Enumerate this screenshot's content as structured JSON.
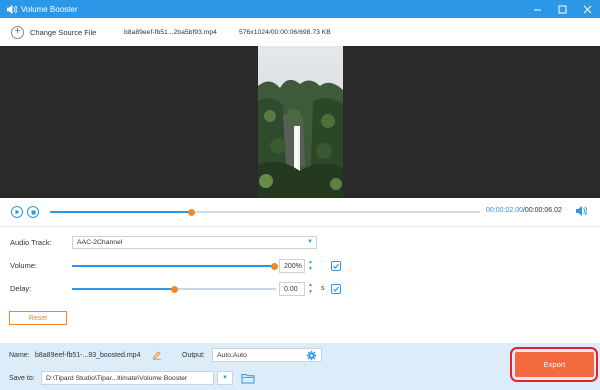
{
  "window": {
    "title": "Volume Booster",
    "icon": "speaker-icon",
    "controls": [
      "minimize-icon",
      "maximize-icon",
      "close-icon"
    ],
    "accent": "#2b97e6"
  },
  "filebar": {
    "change_label": "Change Source File",
    "file_name": "b8a89eef-fb51...2ba5bf93.mp4",
    "file_meta": "576x1024/00:00:06/698.73 KB"
  },
  "playback": {
    "current_time": "00:00:02.00",
    "total_time": "/00:00:06.02",
    "progress_fraction": 0.33
  },
  "settings": {
    "audio_track_label": "Audio Track:",
    "audio_track_value": "AAC-2Channel",
    "volume_label": "Volume:",
    "volume_value": "200%",
    "volume_fraction": 1.0,
    "delay_label": "Delay:",
    "delay_value": "0.00",
    "delay_unit": "s",
    "delay_fraction": 0.5,
    "reset_label": "Reset"
  },
  "output": {
    "name_label": "Name:",
    "name_value": "b8a89eef-fb51-...93_boosted.mp4",
    "output_label": "Output:",
    "output_value": "Auto;Auto",
    "save_label": "Save to:",
    "save_path": "D:\\Tipard Studio\\Tipar...ltimate\\Volume Booster",
    "export_label": "Export",
    "export_color": "#f26a3d",
    "highlight_color": "#e4232b"
  }
}
